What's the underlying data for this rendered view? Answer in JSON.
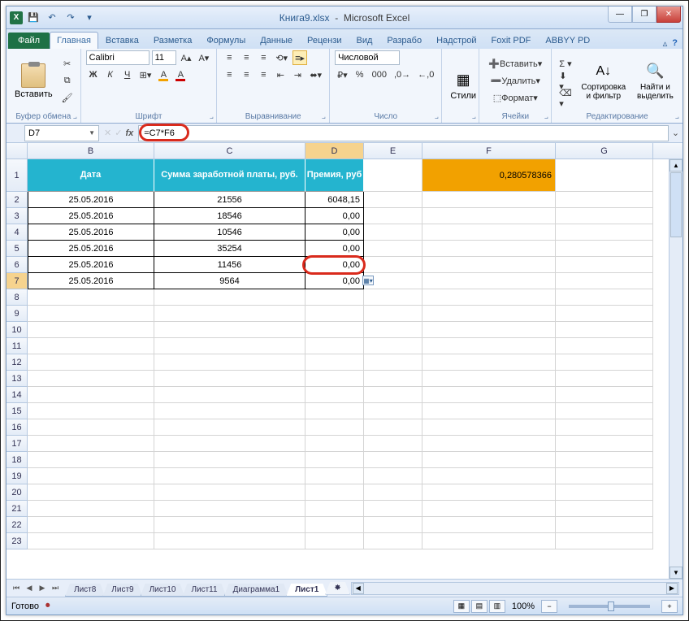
{
  "app": {
    "doc_name": "Книга9.xlsx",
    "app_name": "Microsoft Excel"
  },
  "qat": {
    "save": "💾",
    "undo": "↶",
    "redo": "↷"
  },
  "win": {
    "min": "—",
    "max": "❐",
    "close": "✕"
  },
  "tabs": {
    "file": "Файл",
    "items": [
      "Главная",
      "Вставка",
      "Разметка",
      "Формулы",
      "Данные",
      "Рецензи",
      "Вид",
      "Разрабо",
      "Надстрой",
      "Foxit PDF",
      "ABBYY PD"
    ],
    "active": 0
  },
  "ribbon": {
    "clipboard": {
      "paste": "Вставить",
      "label": "Буфер обмена"
    },
    "font": {
      "name": "Calibri",
      "size": "11",
      "label": "Шрифт",
      "bold": "Ж",
      "italic": "К",
      "underline": "Ч"
    },
    "align": {
      "label": "Выравнивание",
      "wrap": "≡",
      "merge": "⇆"
    },
    "number": {
      "format": "Числовой",
      "label": "Число"
    },
    "styles": {
      "btn": "Стили",
      "label": ""
    },
    "cells": {
      "insert": "Вставить",
      "delete": "Удалить",
      "format": "Формат",
      "label": "Ячейки"
    },
    "editing": {
      "sort": "Сортировка и фильтр",
      "find": "Найти и выделить",
      "label": "Редактирование"
    }
  },
  "namebox": "D7",
  "formula": "=C7*F6",
  "columns": [
    "B",
    "C",
    "D",
    "E",
    "F",
    "G"
  ],
  "sel_col": "D",
  "sel_row": 7,
  "header_row": {
    "B": "Дата",
    "C": "Сумма заработной платы, руб.",
    "D": "Премия, руб"
  },
  "f1_value": "0,280578366",
  "data_rows": [
    {
      "B": "25.05.2016",
      "C": "21556",
      "D": "6048,15"
    },
    {
      "B": "25.05.2016",
      "C": "18546",
      "D": "0,00"
    },
    {
      "B": "25.05.2016",
      "C": "10546",
      "D": "0,00"
    },
    {
      "B": "25.05.2016",
      "C": "35254",
      "D": "0,00"
    },
    {
      "B": "25.05.2016",
      "C": "11456",
      "D": "0,00"
    },
    {
      "B": "25.05.2016",
      "C": "9564",
      "D": "0,00"
    }
  ],
  "empty_rows": [
    8,
    9,
    10,
    11,
    12,
    13,
    14,
    15,
    16,
    17,
    18,
    19,
    20,
    21,
    22,
    23
  ],
  "sheets": {
    "items": [
      "Лист8",
      "Лист9",
      "Лист10",
      "Лист11",
      "Диаграмма1",
      "Лист1"
    ],
    "active": 5
  },
  "status": {
    "ready": "Готово",
    "zoom": "100%"
  }
}
